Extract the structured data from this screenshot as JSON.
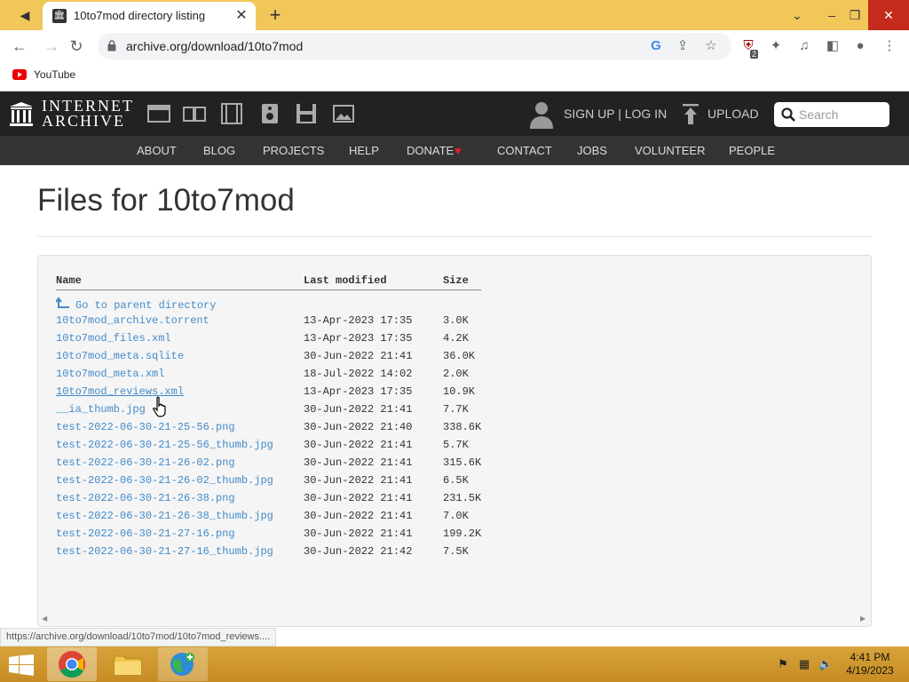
{
  "browser": {
    "tab_title": "10to7mod directory listing",
    "url": "archive.org/download/10to7mod",
    "bookmark": "YouTube",
    "extension_badge": "2"
  },
  "ia": {
    "logo_line1": "INTERNET",
    "logo_line2": "ARCHIVE",
    "signup": "SIGN UP | LOG IN",
    "upload": "UPLOAD",
    "search_placeholder": "Search",
    "nav": [
      "ABOUT",
      "BLOG",
      "PROJECTS",
      "HELP",
      "DONATE",
      "CONTACT",
      "JOBS",
      "VOLUNTEER",
      "PEOPLE"
    ]
  },
  "page": {
    "title": "Files for 10to7mod",
    "headers": {
      "name": "Name",
      "modified": "Last modified",
      "size": "Size"
    },
    "parent": "Go to parent directory",
    "files": [
      {
        "name": "10to7mod_archive.torrent",
        "modified": "13-Apr-2023 17:35",
        "size": "3.0K"
      },
      {
        "name": "10to7mod_files.xml",
        "modified": "13-Apr-2023 17:35",
        "size": "4.2K"
      },
      {
        "name": "10to7mod_meta.sqlite",
        "modified": "30-Jun-2022 21:41",
        "size": "36.0K"
      },
      {
        "name": "10to7mod_meta.xml",
        "modified": "18-Jul-2022 14:02",
        "size": "2.0K"
      },
      {
        "name": "10to7mod_reviews.xml",
        "modified": "13-Apr-2023 17:35",
        "size": "10.9K"
      },
      {
        "name": "__ia_thumb.jpg",
        "modified": "30-Jun-2022 21:41",
        "size": "7.7K"
      },
      {
        "name": "test-2022-06-30-21-25-56.png",
        "modified": "30-Jun-2022 21:40",
        "size": "338.6K"
      },
      {
        "name": "test-2022-06-30-21-25-56_thumb.jpg",
        "modified": "30-Jun-2022 21:41",
        "size": "5.7K"
      },
      {
        "name": "test-2022-06-30-21-26-02.png",
        "modified": "30-Jun-2022 21:41",
        "size": "315.6K"
      },
      {
        "name": "test-2022-06-30-21-26-02_thumb.jpg",
        "modified": "30-Jun-2022 21:41",
        "size": "6.5K"
      },
      {
        "name": "test-2022-06-30-21-26-38.png",
        "modified": "30-Jun-2022 21:41",
        "size": "231.5K"
      },
      {
        "name": "test-2022-06-30-21-26-38_thumb.jpg",
        "modified": "30-Jun-2022 21:41",
        "size": "7.0K"
      },
      {
        "name": "test-2022-06-30-21-27-16.png",
        "modified": "30-Jun-2022 21:41",
        "size": "199.2K"
      },
      {
        "name": "test-2022-06-30-21-27-16_thumb.jpg",
        "modified": "30-Jun-2022 21:42",
        "size": "7.5K"
      }
    ]
  },
  "status_url": "https://archive.org/download/10to7mod/10to7mod_reviews....",
  "taskbar": {
    "time": "4:41 PM",
    "date": "4/19/2023"
  },
  "colors": {
    "tabstrip": "#f1c75a",
    "ia_dark": "#222222",
    "link": "#428bca",
    "donate_heart": "#e0202a"
  }
}
